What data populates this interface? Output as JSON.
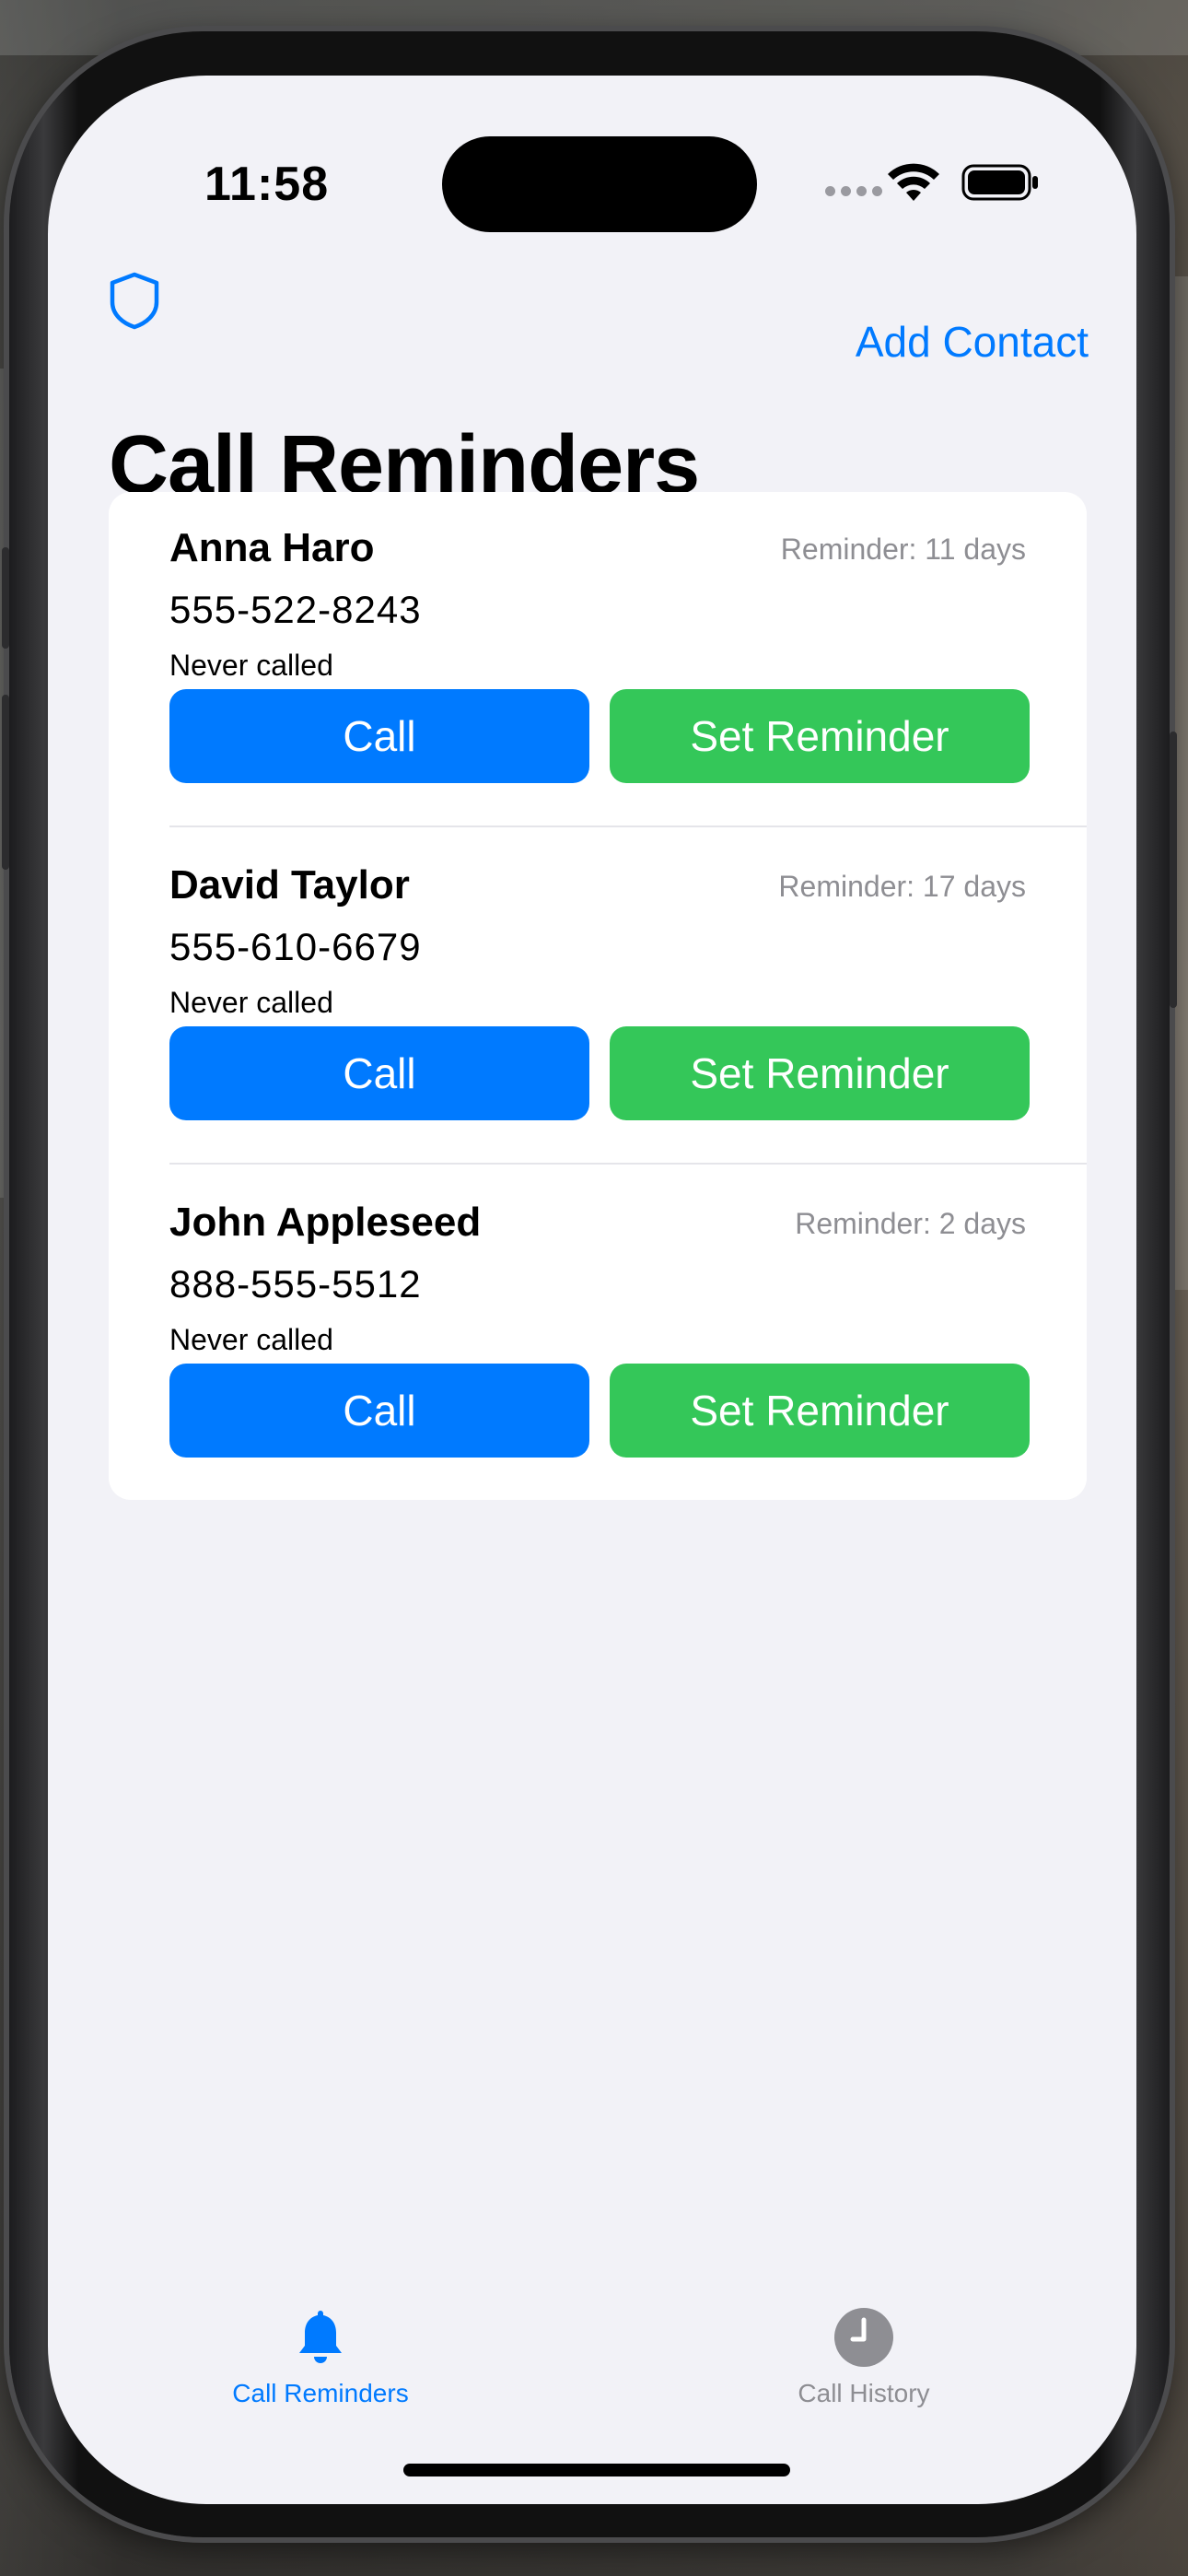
{
  "status_bar": {
    "time": "11:58"
  },
  "nav": {
    "add_contact_label": "Add Contact"
  },
  "page": {
    "title": "Call Reminders"
  },
  "contacts": [
    {
      "name": "Anna Haro",
      "phone": "555-522-8243",
      "reminder": "Reminder: 11 days",
      "last_called": "Never called",
      "call_label": "Call",
      "set_reminder_label": "Set Reminder"
    },
    {
      "name": "David Taylor",
      "phone": "555-610-6679",
      "reminder": "Reminder: 17 days",
      "last_called": "Never called",
      "call_label": "Call",
      "set_reminder_label": "Set Reminder"
    },
    {
      "name": "John Appleseed",
      "phone": "888-555-5512",
      "reminder": "Reminder: 2 days",
      "last_called": "Never called",
      "call_label": "Call",
      "set_reminder_label": "Set Reminder"
    }
  ],
  "tabs": [
    {
      "label": "Call Reminders",
      "icon": "bell-icon",
      "selected": true
    },
    {
      "label": "Call History",
      "icon": "clock-icon",
      "selected": false
    }
  ],
  "colors": {
    "accent": "#007aff",
    "call_button": "#007aff",
    "reminder_button": "#34c759",
    "background": "#f2f2f7",
    "secondary_text": "#8e8e93"
  }
}
